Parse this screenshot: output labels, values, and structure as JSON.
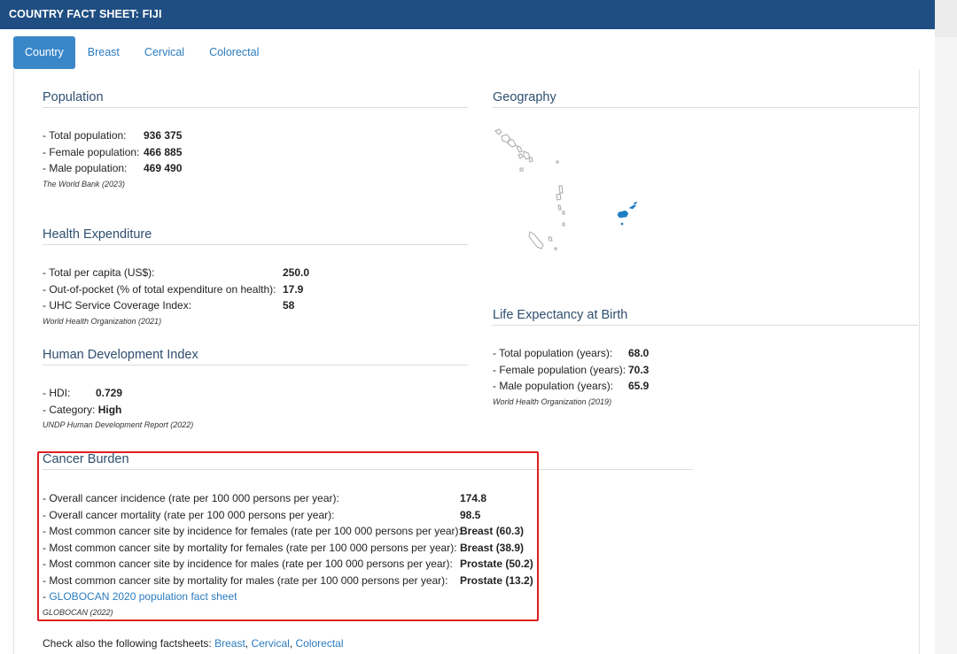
{
  "header": {
    "title": "COUNTRY FACT SHEET: FIJI"
  },
  "tabs": [
    {
      "label": "Country",
      "active": true
    },
    {
      "label": "Breast",
      "active": false
    },
    {
      "label": "Cervical",
      "active": false
    },
    {
      "label": "Colorectal",
      "active": false
    }
  ],
  "population": {
    "title": "Population",
    "rows": [
      {
        "label": "- Total population:",
        "value": "936 375"
      },
      {
        "label": "- Female population:",
        "value": "466 885"
      },
      {
        "label": "- Male population:",
        "value": "469 490"
      }
    ],
    "source": "The World Bank (2023)"
  },
  "health_expenditure": {
    "title": "Health Expenditure",
    "rows": [
      {
        "label": "- Total per capita (US$):",
        "value": "250.0"
      },
      {
        "label": "- Out-of-pocket (% of total expenditure on health):",
        "value": "17.9"
      },
      {
        "label": "- UHC Service Coverage Index:",
        "value": "58"
      }
    ],
    "source": "World Health Organization (2021)"
  },
  "hdi": {
    "title": "Human Development Index",
    "hdi_label": "- HDI:",
    "hdi_value": "0.729",
    "category_label": "- Category: ",
    "category_value": "High",
    "source": "UNDP Human Development Report (2022)"
  },
  "geography": {
    "title": "Geography"
  },
  "life_expectancy": {
    "title": "Life Expectancy at Birth",
    "rows": [
      {
        "label": "- Total population (years):",
        "value": "68.0"
      },
      {
        "label": "- Female population (years):",
        "value": "70.3"
      },
      {
        "label": "- Male population (years):",
        "value": "65.9"
      }
    ],
    "source": "World Health Organization (2019)"
  },
  "cancer_burden": {
    "title": "Cancer Burden",
    "rows": [
      {
        "label": "- Overall cancer incidence (rate per 100 000 persons per year):",
        "value": "174.8"
      },
      {
        "label": "- Overall cancer mortality (rate per 100 000 persons per year):",
        "value": "98.5"
      },
      {
        "label": "- Most common cancer site by incidence for females (rate per 100 000 persons per year):",
        "value": "Breast (60.3)"
      },
      {
        "label": "- Most common cancer site by mortality for females (rate per 100 000 persons per year):",
        "value": "Breast (38.9)"
      },
      {
        "label": "- Most common cancer site by incidence for males (rate per 100 000 persons per year):",
        "value": "Prostate (50.2)"
      },
      {
        "label": "- Most common cancer site by mortality for males (rate per 100 000 persons per year):",
        "value": "Prostate (13.2)"
      }
    ],
    "link_prefix": "- ",
    "link_label": "GLOBOCAN 2020 population fact sheet",
    "source": "GLOBOCAN (2022)"
  },
  "check_also": {
    "prefix": "Check also the following factsheets: ",
    "links": [
      "Breast",
      "Cervical",
      "Colorectal"
    ],
    "sep": ", "
  },
  "colors": {
    "header_bg": "#1f4e82",
    "tab_active": "#3a87c8",
    "link": "#2a7bbf",
    "highlight": "#e02020",
    "map_highlight": "#1f7fc4"
  }
}
